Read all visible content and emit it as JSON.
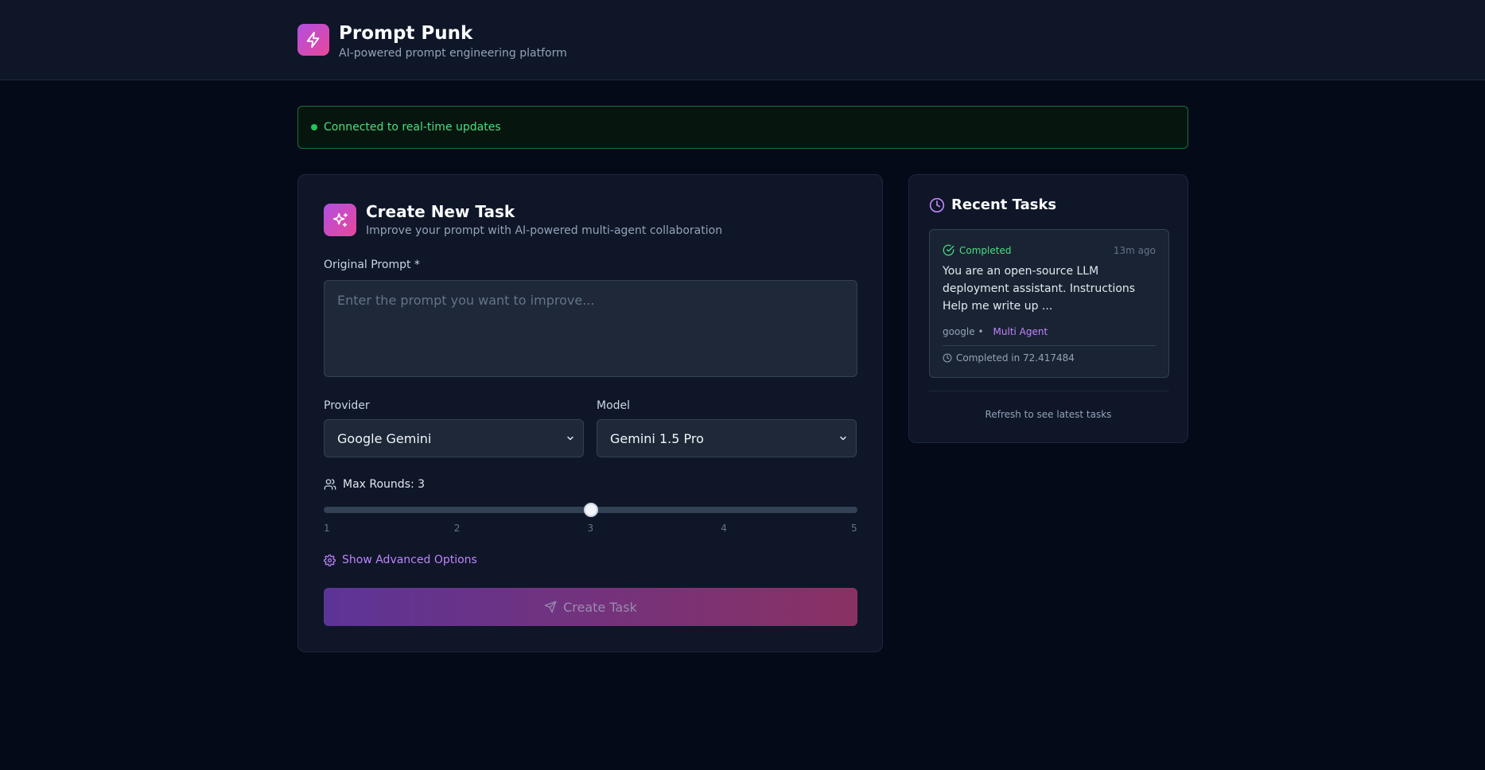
{
  "app": {
    "title": "Prompt Punk",
    "subtitle": "AI-powered prompt engineering platform"
  },
  "connection": {
    "status_text": "Connected to real-time updates",
    "color": "#22c55e"
  },
  "create_task": {
    "title": "Create New Task",
    "subtitle": "Improve your prompt with AI-powered multi-agent collaboration",
    "prompt_label": "Original Prompt *",
    "prompt_placeholder": "Enter the prompt you want to improve...",
    "prompt_value": "",
    "provider_label": "Provider",
    "provider_value": "Google Gemini",
    "model_label": "Model",
    "model_value": "Gemini 1.5 Pro",
    "max_rounds_label": "Max Rounds: 3",
    "max_rounds_value": 3,
    "max_rounds_ticks": [
      "1",
      "2",
      "3",
      "4",
      "5"
    ],
    "advanced_label": "Show Advanced Options",
    "submit_label": "Create Task"
  },
  "recent_tasks": {
    "title": "Recent Tasks",
    "items": [
      {
        "status": "Completed",
        "time_ago": "13m ago",
        "text": "You are an open-source LLM deployment assistant. Instructions Help me write up ...",
        "provider": "google •",
        "mode": "Multi Agent",
        "completed_text": "Completed in 72.417484"
      }
    ],
    "refresh_hint": "Refresh to see latest tasks"
  },
  "colors": {
    "accent_start": "#b14fe0",
    "accent_end": "#e9479a",
    "success": "#4ade80",
    "link": "#c084fc"
  },
  "icons": {
    "brand": "lightning-icon",
    "create": "sparkles-icon",
    "rounds": "users-icon",
    "advanced": "gear-icon",
    "submit": "send-icon",
    "recent": "clock-icon",
    "status": "check-circle-icon"
  }
}
